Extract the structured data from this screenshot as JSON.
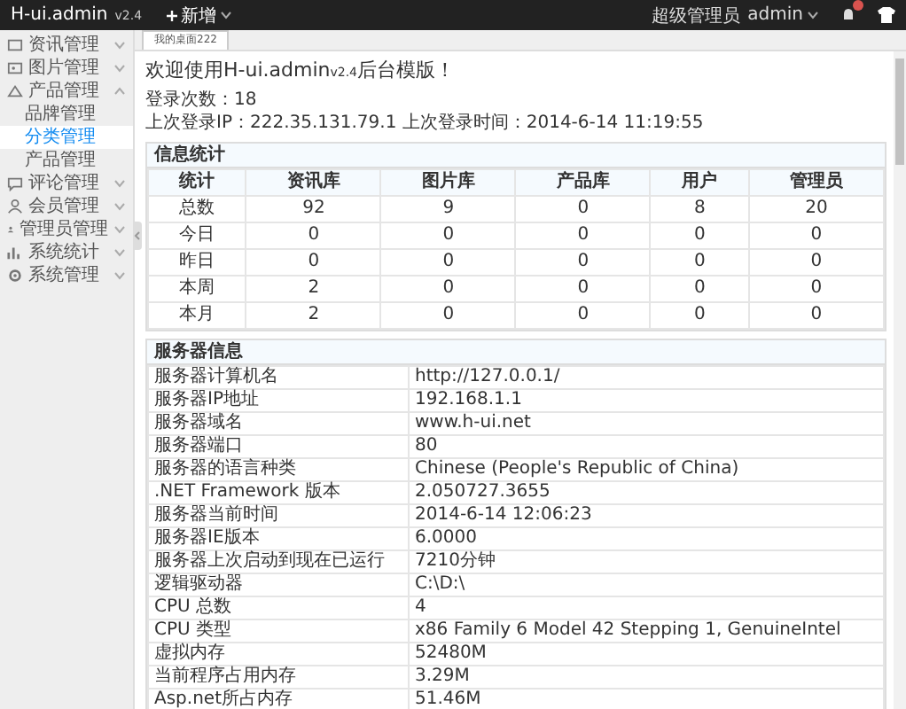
{
  "topbar": {
    "logo": "H-ui.admin",
    "version": "v2.4",
    "add_menu": "新增",
    "role": "超级管理员",
    "user": "admin"
  },
  "sidebar": {
    "items": [
      {
        "label": "资讯管理",
        "expanded": false
      },
      {
        "label": "图片管理",
        "expanded": false
      },
      {
        "label": "产品管理",
        "expanded": true,
        "children": [
          {
            "label": "品牌管理",
            "selected": false
          },
          {
            "label": "分类管理",
            "selected": true
          },
          {
            "label": "产品管理",
            "selected": false
          }
        ]
      },
      {
        "label": "评论管理",
        "expanded": false
      },
      {
        "label": "会员管理",
        "expanded": false
      },
      {
        "label": "管理员管理",
        "expanded": false
      },
      {
        "label": "系统统计",
        "expanded": false
      },
      {
        "label": "系统管理",
        "expanded": false
      }
    ]
  },
  "tabs": [
    {
      "label": "我的桌面222",
      "selected": true
    }
  ],
  "welcome": {
    "before": "欢迎使用H-ui.admin",
    "version": "v2.4",
    "after": "后台模版！"
  },
  "login_count": "登录次数：18",
  "last_login": "上次登录IP：222.35.131.79.1 上次登录时间：2014-6-14 11:19:55",
  "stats": {
    "title": "信息统计",
    "columns": [
      "统计",
      "资讯库",
      "图片库",
      "产品库",
      "用户",
      "管理员"
    ],
    "rows": [
      [
        "总数",
        "92",
        "9",
        "0",
        "8",
        "20"
      ],
      [
        "今日",
        "0",
        "0",
        "0",
        "0",
        "0"
      ],
      [
        "昨日",
        "0",
        "0",
        "0",
        "0",
        "0"
      ],
      [
        "本周",
        "2",
        "0",
        "0",
        "0",
        "0"
      ],
      [
        "本月",
        "2",
        "0",
        "0",
        "0",
        "0"
      ]
    ]
  },
  "server": {
    "title": "服务器信息",
    "rows": [
      [
        "服务器计算机名",
        "http://127.0.0.1/"
      ],
      [
        "服务器IP地址",
        "192.168.1.1"
      ],
      [
        "服务器域名",
        "www.h-ui.net"
      ],
      [
        "服务器端口",
        "80"
      ],
      [
        "服务器的语言种类",
        "Chinese (People's Republic of China)"
      ],
      [
        ".NET Framework 版本",
        "2.050727.3655"
      ],
      [
        "服务器当前时间",
        "2014-6-14 12:06:23"
      ],
      [
        "服务器IE版本",
        "6.0000"
      ],
      [
        "服务器上次启动到现在已运行",
        "7210分钟"
      ],
      [
        "逻辑驱动器",
        "C:\\D:\\"
      ],
      [
        "CPU 总数",
        "4"
      ],
      [
        "CPU 类型",
        "x86 Family 6 Model 42 Stepping 1, GenuineIntel"
      ],
      [
        "虚拟内存",
        "52480M"
      ],
      [
        "当前程序占用内存",
        "3.29M"
      ],
      [
        "Asp.net所占内存",
        "51.46M"
      ]
    ]
  }
}
